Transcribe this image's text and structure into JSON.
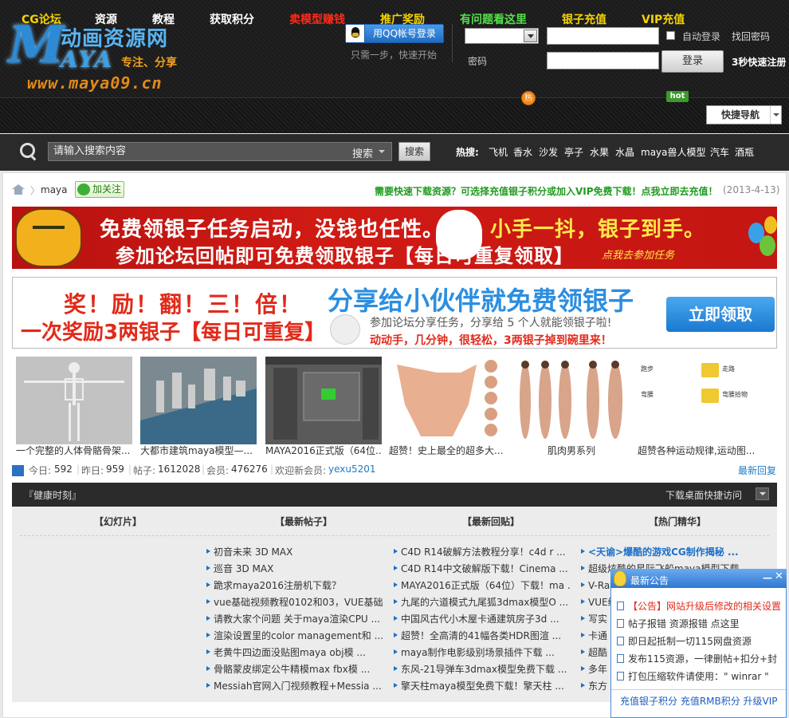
{
  "header": {
    "logo": {
      "title": "动画资源网",
      "m": "M",
      "aya": "AYA",
      "slogan": "专注、分享",
      "url": "www.maya09.cn"
    },
    "qq_login": "用QQ帐号登录",
    "qq_note": "只需一步，快速开始",
    "password_label": "密码",
    "auto_login": "自动登录",
    "find_password": "找回密码",
    "login_button": "登录",
    "quick_register": "3秒快速注册"
  },
  "nav": {
    "items": [
      {
        "label": "CG论坛",
        "color": "#f5d300"
      },
      {
        "label": "资源",
        "color": "#ffffff"
      },
      {
        "label": "教程",
        "color": "#ffffff"
      },
      {
        "label": "获取积分",
        "color": "#ffffff"
      },
      {
        "label": "卖模型赚钱",
        "color": "#ff2a1a"
      },
      {
        "label": "推广奖励",
        "color": "#f5d300"
      },
      {
        "label": "有问题看这里",
        "color": "#55e04a"
      },
      {
        "label": "银子充值",
        "color": "#f5d300"
      },
      {
        "label": "VIP充值",
        "color": "#f5d300"
      }
    ],
    "hot_badge": "hot",
    "new_badge": "热",
    "quick_nav": "快捷导航"
  },
  "search": {
    "placeholder": "请输入搜索内容",
    "type": "搜索",
    "button": "搜索",
    "hot_label": "热搜:",
    "hot_keywords": [
      "飞机",
      "香水",
      "沙发",
      "亭子",
      "水果",
      "水晶",
      "maya兽人模型",
      "汽车",
      "酒瓶"
    ]
  },
  "breadcrumb": {
    "home_icon": "home-icon",
    "current": "maya",
    "follow": "加关注"
  },
  "promo": {
    "link": "需要快速下载资源？可选择充值银子积分或加入VIP免费下载！点我立即去充值！",
    "date": "(2013-4-13)"
  },
  "banner1": {
    "line1": "免费领银子任务启动，没钱也任性。",
    "line1b": "小手一抖，银子到手。",
    "line2": "参加论坛回帖即可免费领取银子【每日可重复领取】",
    "line3": "点我去参加任务"
  },
  "banner2": {
    "left1": "奖！励！翻！三！倍！",
    "left2": "一次奖励3两银子【每日可重复】",
    "right1": "分享给小伙伴就免费领银子",
    "right2": "参加论坛分享任务，分享给 5 个人就能领银子啦!",
    "right3": "动动手，几分钟，很轻松，3两银子掉到碗里来！",
    "claim": "立即领取"
  },
  "thumbs": [
    {
      "caption": "一个完整的人体骨骼骨架..."
    },
    {
      "caption": "大都市建筑maya模型—..."
    },
    {
      "caption": "MAYA2016正式版（64位..."
    },
    {
      "caption": "超赞！史上最全的超多大..."
    },
    {
      "caption": "肌肉男系列"
    },
    {
      "caption": "超赞各种运动规律,运动图..."
    }
  ],
  "thumb6_labels": {
    "a": "跑步",
    "b": "走路",
    "c": "弯腰",
    "d": "弯腰拾物"
  },
  "stats": {
    "today_label": "今日:",
    "today": "592",
    "yesterday_label": "昨日:",
    "yesterday": "959",
    "posts_label": "帖子:",
    "posts": "1612028",
    "members_label": "会员:",
    "members": "476276",
    "welcome_label": "欢迎新会员:",
    "new_member": "yexu5201",
    "latest_reply": "最新回复"
  },
  "portal": {
    "title": "『健康时刻』",
    "desktop_link": "下载桌面快捷访问",
    "columns": [
      "【幻灯片】",
      "【最新帖子】",
      "【最新回贴】",
      "【热门精华】"
    ],
    "latest_posts": [
      "初音未来 3D MAX",
      "巡音 3D MAX",
      "跪求maya2016注册机下载？",
      "vue基础视频教程0102和03，VUE基础...",
      "请教大家个问题 关于maya渲染CPU ...",
      "渲染设置里的color management和 ...",
      "老黄牛四边面没贴图maya obj模 ...",
      "骨骼蒙皮绑定公牛精模max fbx模 ...",
      "Messiah官网入门视频教程+Messia ..."
    ],
    "latest_replies": [
      "C4D R14破解方法教程分享！c4d r ...",
      "C4D R14中文破解版下载！Cinema ...",
      "MAYA2016正式版（64位）下载！ma ...",
      "九尾的六道模式九尾狐3dmax模型O ...",
      "中国风古代小木屋卡通建筑房子3d ...",
      "超赞！全高清的41幅各类HDR图渲 ...",
      "maya制作电影级别场景插件下载 ...",
      "东风-21导弹车3dmax模型免费下载 ...",
      "擎天柱maya模型免费下载！擎天柱 ..."
    ],
    "hot_picks": [
      "<天谕>爆酷的游戏CG制作揭秘 ...",
      "超级炫酷的星际飞船maya模型下载",
      "V-Ray",
      "VUE编",
      "写实",
      "卡通",
      "超酷",
      "多年",
      "东方"
    ]
  },
  "announcement": {
    "title": "最新公告",
    "items": [
      "【公告】网站升级后修改的相关设置",
      "帖子报错 资源报错 点这里",
      "即日起抵制一切115网盘资源",
      "发布115资源，一律删帖+扣分+封",
      "打包压缩软件请使用：\" winrar \""
    ],
    "footer": "充值银子积分 充值RMB积分 升级VIP"
  }
}
